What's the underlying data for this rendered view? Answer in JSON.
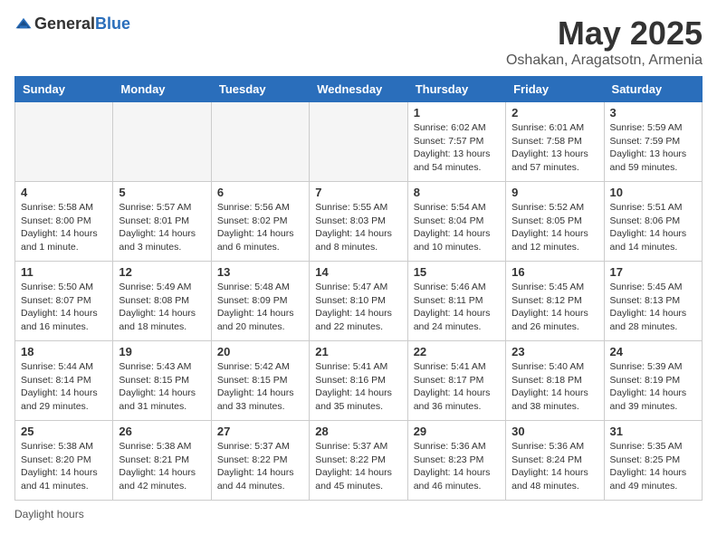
{
  "header": {
    "logo_general": "General",
    "logo_blue": "Blue",
    "month_title": "May 2025",
    "location": "Oshakan, Aragatsotn, Armenia"
  },
  "days_of_week": [
    "Sunday",
    "Monday",
    "Tuesday",
    "Wednesday",
    "Thursday",
    "Friday",
    "Saturday"
  ],
  "weeks": [
    [
      {
        "day": "",
        "empty": true
      },
      {
        "day": "",
        "empty": true
      },
      {
        "day": "",
        "empty": true
      },
      {
        "day": "",
        "empty": true
      },
      {
        "day": "1",
        "sunrise": "Sunrise: 6:02 AM",
        "sunset": "Sunset: 7:57 PM",
        "daylight": "Daylight: 13 hours and 54 minutes."
      },
      {
        "day": "2",
        "sunrise": "Sunrise: 6:01 AM",
        "sunset": "Sunset: 7:58 PM",
        "daylight": "Daylight: 13 hours and 57 minutes."
      },
      {
        "day": "3",
        "sunrise": "Sunrise: 5:59 AM",
        "sunset": "Sunset: 7:59 PM",
        "daylight": "Daylight: 13 hours and 59 minutes."
      }
    ],
    [
      {
        "day": "4",
        "sunrise": "Sunrise: 5:58 AM",
        "sunset": "Sunset: 8:00 PM",
        "daylight": "Daylight: 14 hours and 1 minute."
      },
      {
        "day": "5",
        "sunrise": "Sunrise: 5:57 AM",
        "sunset": "Sunset: 8:01 PM",
        "daylight": "Daylight: 14 hours and 3 minutes."
      },
      {
        "day": "6",
        "sunrise": "Sunrise: 5:56 AM",
        "sunset": "Sunset: 8:02 PM",
        "daylight": "Daylight: 14 hours and 6 minutes."
      },
      {
        "day": "7",
        "sunrise": "Sunrise: 5:55 AM",
        "sunset": "Sunset: 8:03 PM",
        "daylight": "Daylight: 14 hours and 8 minutes."
      },
      {
        "day": "8",
        "sunrise": "Sunrise: 5:54 AM",
        "sunset": "Sunset: 8:04 PM",
        "daylight": "Daylight: 14 hours and 10 minutes."
      },
      {
        "day": "9",
        "sunrise": "Sunrise: 5:52 AM",
        "sunset": "Sunset: 8:05 PM",
        "daylight": "Daylight: 14 hours and 12 minutes."
      },
      {
        "day": "10",
        "sunrise": "Sunrise: 5:51 AM",
        "sunset": "Sunset: 8:06 PM",
        "daylight": "Daylight: 14 hours and 14 minutes."
      }
    ],
    [
      {
        "day": "11",
        "sunrise": "Sunrise: 5:50 AM",
        "sunset": "Sunset: 8:07 PM",
        "daylight": "Daylight: 14 hours and 16 minutes."
      },
      {
        "day": "12",
        "sunrise": "Sunrise: 5:49 AM",
        "sunset": "Sunset: 8:08 PM",
        "daylight": "Daylight: 14 hours and 18 minutes."
      },
      {
        "day": "13",
        "sunrise": "Sunrise: 5:48 AM",
        "sunset": "Sunset: 8:09 PM",
        "daylight": "Daylight: 14 hours and 20 minutes."
      },
      {
        "day": "14",
        "sunrise": "Sunrise: 5:47 AM",
        "sunset": "Sunset: 8:10 PM",
        "daylight": "Daylight: 14 hours and 22 minutes."
      },
      {
        "day": "15",
        "sunrise": "Sunrise: 5:46 AM",
        "sunset": "Sunset: 8:11 PM",
        "daylight": "Daylight: 14 hours and 24 minutes."
      },
      {
        "day": "16",
        "sunrise": "Sunrise: 5:45 AM",
        "sunset": "Sunset: 8:12 PM",
        "daylight": "Daylight: 14 hours and 26 minutes."
      },
      {
        "day": "17",
        "sunrise": "Sunrise: 5:45 AM",
        "sunset": "Sunset: 8:13 PM",
        "daylight": "Daylight: 14 hours and 28 minutes."
      }
    ],
    [
      {
        "day": "18",
        "sunrise": "Sunrise: 5:44 AM",
        "sunset": "Sunset: 8:14 PM",
        "daylight": "Daylight: 14 hours and 29 minutes."
      },
      {
        "day": "19",
        "sunrise": "Sunrise: 5:43 AM",
        "sunset": "Sunset: 8:15 PM",
        "daylight": "Daylight: 14 hours and 31 minutes."
      },
      {
        "day": "20",
        "sunrise": "Sunrise: 5:42 AM",
        "sunset": "Sunset: 8:15 PM",
        "daylight": "Daylight: 14 hours and 33 minutes."
      },
      {
        "day": "21",
        "sunrise": "Sunrise: 5:41 AM",
        "sunset": "Sunset: 8:16 PM",
        "daylight": "Daylight: 14 hours and 35 minutes."
      },
      {
        "day": "22",
        "sunrise": "Sunrise: 5:41 AM",
        "sunset": "Sunset: 8:17 PM",
        "daylight": "Daylight: 14 hours and 36 minutes."
      },
      {
        "day": "23",
        "sunrise": "Sunrise: 5:40 AM",
        "sunset": "Sunset: 8:18 PM",
        "daylight": "Daylight: 14 hours and 38 minutes."
      },
      {
        "day": "24",
        "sunrise": "Sunrise: 5:39 AM",
        "sunset": "Sunset: 8:19 PM",
        "daylight": "Daylight: 14 hours and 39 minutes."
      }
    ],
    [
      {
        "day": "25",
        "sunrise": "Sunrise: 5:38 AM",
        "sunset": "Sunset: 8:20 PM",
        "daylight": "Daylight: 14 hours and 41 minutes."
      },
      {
        "day": "26",
        "sunrise": "Sunrise: 5:38 AM",
        "sunset": "Sunset: 8:21 PM",
        "daylight": "Daylight: 14 hours and 42 minutes."
      },
      {
        "day": "27",
        "sunrise": "Sunrise: 5:37 AM",
        "sunset": "Sunset: 8:22 PM",
        "daylight": "Daylight: 14 hours and 44 minutes."
      },
      {
        "day": "28",
        "sunrise": "Sunrise: 5:37 AM",
        "sunset": "Sunset: 8:22 PM",
        "daylight": "Daylight: 14 hours and 45 minutes."
      },
      {
        "day": "29",
        "sunrise": "Sunrise: 5:36 AM",
        "sunset": "Sunset: 8:23 PM",
        "daylight": "Daylight: 14 hours and 46 minutes."
      },
      {
        "day": "30",
        "sunrise": "Sunrise: 5:36 AM",
        "sunset": "Sunset: 8:24 PM",
        "daylight": "Daylight: 14 hours and 48 minutes."
      },
      {
        "day": "31",
        "sunrise": "Sunrise: 5:35 AM",
        "sunset": "Sunset: 8:25 PM",
        "daylight": "Daylight: 14 hours and 49 minutes."
      }
    ]
  ],
  "footer": {
    "daylight_label": "Daylight hours"
  }
}
